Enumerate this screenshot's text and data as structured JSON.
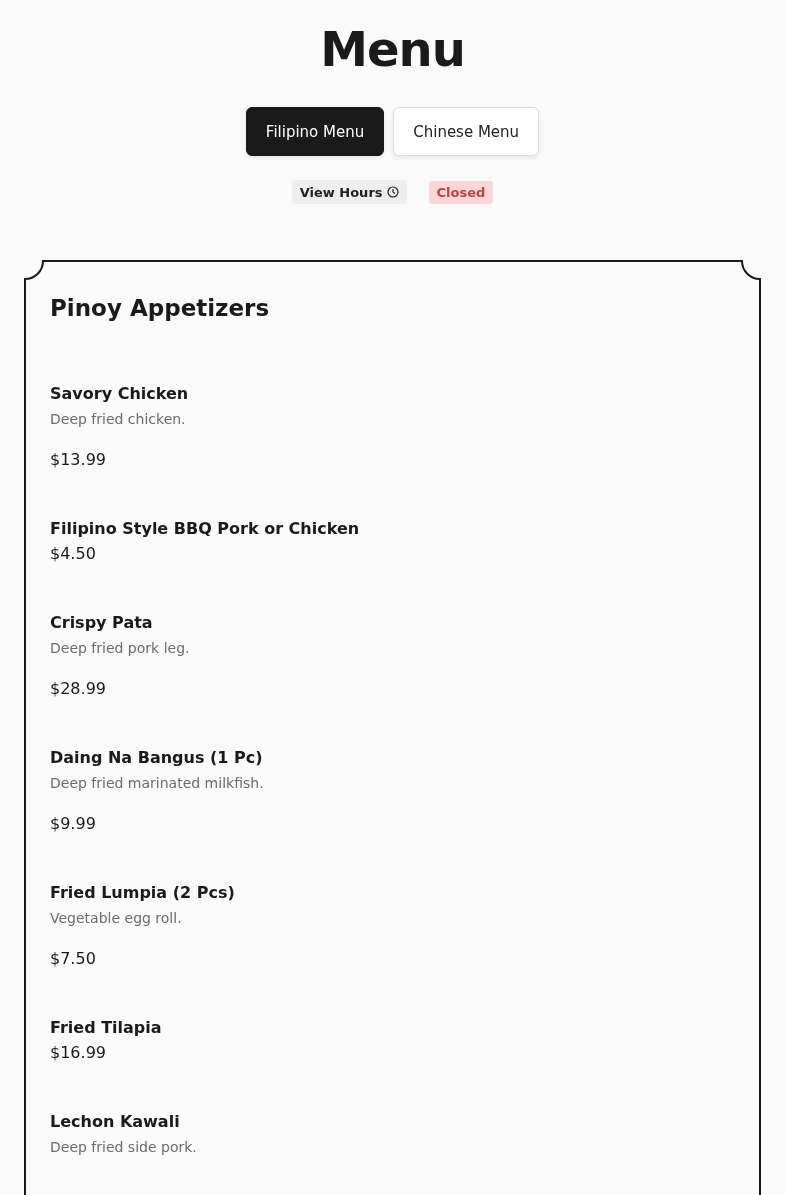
{
  "title": "Menu",
  "tabs": [
    {
      "label": "Filipino Menu",
      "selected": true
    },
    {
      "label": "Chinese Menu",
      "selected": false
    }
  ],
  "hours_button": {
    "label": "View Hours"
  },
  "status": {
    "label": "Closed",
    "open": false
  },
  "section": {
    "title": "Pinoy Appetizers",
    "items": [
      {
        "name": "Savory Chicken",
        "description": "Deep fried chicken.",
        "price": "$13.99"
      },
      {
        "name": "Filipino Style BBQ Pork or Chicken",
        "price": "$4.50"
      },
      {
        "name": "Crispy Pata",
        "description": "Deep fried pork leg.",
        "price": "$28.99"
      },
      {
        "name": "Daing Na Bangus (1 Pc)",
        "description": "Deep fried marinated milkfish.",
        "price": "$9.99"
      },
      {
        "name": "Fried Lumpia (2 Pcs)",
        "description": "Vegetable egg roll.",
        "price": "$7.50"
      },
      {
        "name": "Fried Tilapia",
        "price": "$16.99"
      },
      {
        "name": "Lechon Kawali",
        "description": "Deep fried side pork."
      }
    ]
  }
}
